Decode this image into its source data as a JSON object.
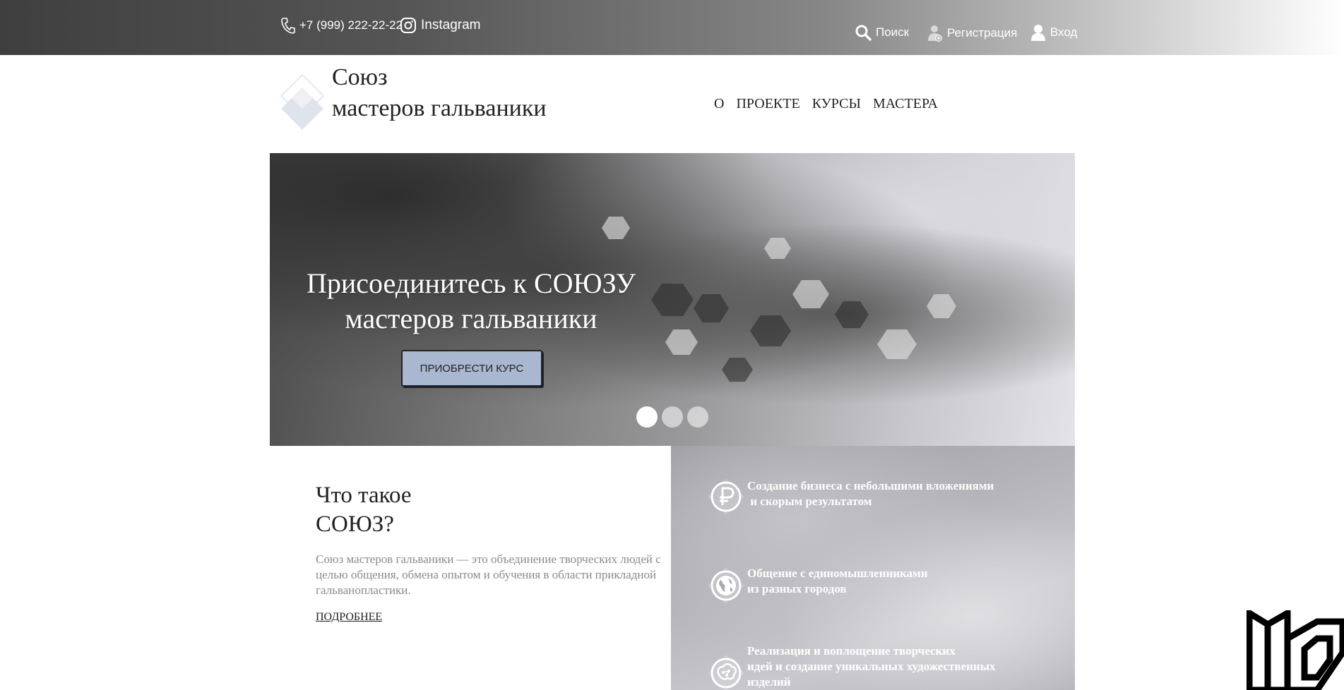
{
  "topbar": {
    "phone": "+7 (999) 222-22-22",
    "instagram": "Instagram",
    "search": "Поиск",
    "register": "Регистрация",
    "login": "Вход"
  },
  "header": {
    "logo_line1": "Союз",
    "logo_line2": "мастеров гальваники",
    "nav": [
      "О",
      "ПРОЕКТЕ",
      "КУРСЫ",
      "МАСТЕРА"
    ]
  },
  "hero": {
    "title_line1": "Присоединитесь к СОЮЗУ",
    "title_line2": "мастеров гальваники",
    "button": "ПРИОБРЕСТИ КУРС",
    "slides_total": 3,
    "slide_active": 1
  },
  "about": {
    "title_line1": "Что такое",
    "title_line2": "СОЮЗ?",
    "text": "Союз мастеров гальваники —  это объединение творческих людей с целью общения, обмена опытом и обучения в области прикладной гальванопластики.",
    "more": "ПОДРОБНЕЕ"
  },
  "features": [
    {
      "icon": "ruble-icon",
      "line1": "Создание бизнеса с небольшими вложениями",
      "line2": " и скорым результатом",
      "line3": ""
    },
    {
      "icon": "globe-icon",
      "line1": "Общение с единомышленниками",
      "line2": "из разных городов",
      "line3": ""
    },
    {
      "icon": "brain-icon",
      "line1": "Реализация и воплощение творческих",
      "line2": "идей и создание уникальных художественных",
      "line3": "изделий"
    }
  ],
  "colors": {
    "button_bg": "#a9b7d0",
    "topbar_dark": "#3f3f3f"
  }
}
